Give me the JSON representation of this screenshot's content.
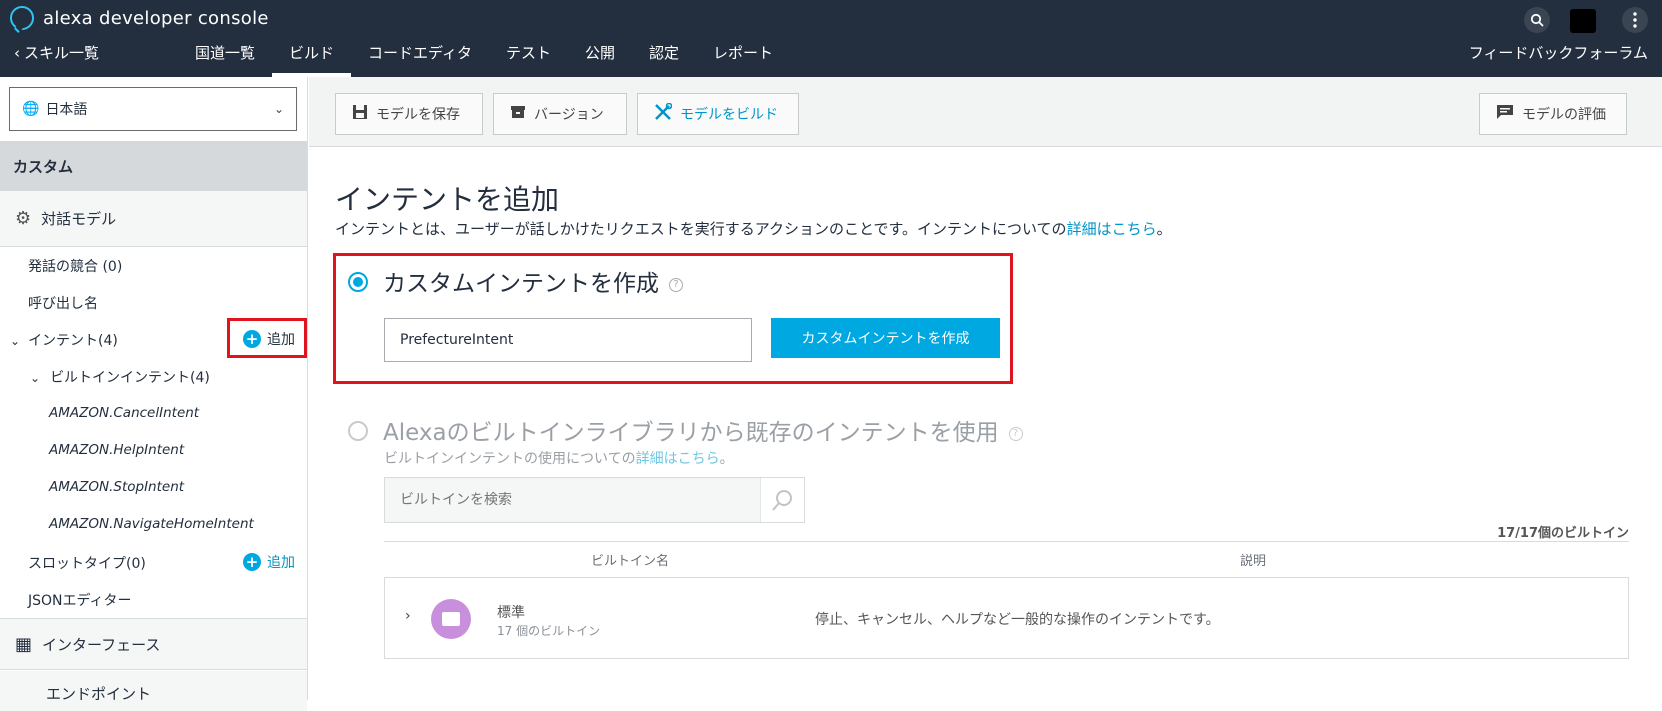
{
  "header": {
    "brand": "alexa developer console",
    "back_label": "スキル一覧",
    "nav": [
      "国道一覧",
      "ビルド",
      "コードエディタ",
      "テスト",
      "公開",
      "認定",
      "レポート"
    ],
    "feedback": "フィードバックフォーラム",
    "accent_color": "#31c4f3"
  },
  "sidebar": {
    "locale": "日本語",
    "section_custom": "カスタム",
    "section_model": "対話モデル",
    "utterance_conflicts": "発話の競合 (0)",
    "invocation": "呼び出し名",
    "intents": "インテント(4)",
    "add_label": "追加",
    "builtin_intents": "ビルトインインテント(4)",
    "builtin_items": [
      "AMAZON.CancelIntent",
      "AMAZON.HelpIntent",
      "AMAZON.StopIntent",
      "AMAZON.NavigateHomeIntent"
    ],
    "slot_types": "スロットタイプ(0)",
    "slot_add_label": "追加",
    "json_editor": "JSONエディター",
    "interfaces": "インターフェース",
    "endpoint": "エンドポイント"
  },
  "toolbar": {
    "save_model": "モデルを保存",
    "version": "バージョン",
    "build_model": "モデルをビルド",
    "evaluate_model": "モデルの評価"
  },
  "main": {
    "title": "インテントを追加",
    "desc_prefix": "インテントとは、ユーザーが話しかけたリクエストを実行するアクションのことです。インテントについての",
    "desc_link": "詳細はこちら",
    "desc_suffix": "。",
    "option_custom": "カスタムインテントを作成",
    "intent_name_value": "PrefectureIntent",
    "create_button": "カスタムインテントを作成",
    "option_builtin": "Alexaのビルトインライブラリから既存のインテントを使用",
    "builtin_sub_prefix": "ビルトインインテントの使用についての",
    "builtin_sub_link": "詳細はこちら",
    "builtin_sub_suffix": "。",
    "search_placeholder": "ビルトインを検索",
    "count": "17/17個のビルトイン",
    "col_name": "ビルトイン名",
    "col_desc": "説明",
    "row": {
      "name": "標準",
      "sub": "17 個のビルトイン",
      "desc": "停止、キャンセル、ヘルプなど一般的な操作のインテントです。"
    },
    "highlight_color": "#e0141e",
    "primary_color": "#00a8e1"
  }
}
